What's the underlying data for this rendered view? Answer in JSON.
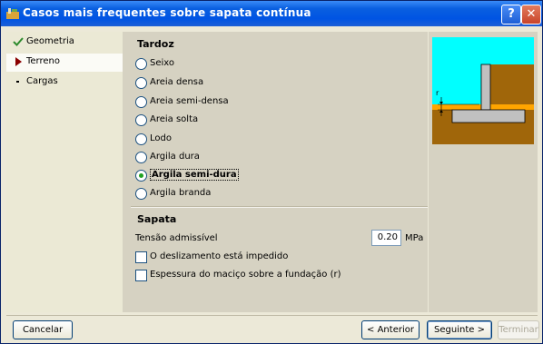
{
  "window": {
    "title": "Casos mais frequentes sobre sapata contínua",
    "help_label": "?",
    "close_label": "✕"
  },
  "sidebar": {
    "items": [
      {
        "label": "Geometria",
        "icon": "checkmark-icon"
      },
      {
        "label": "Terreno",
        "icon": "triangle-arrow-icon"
      },
      {
        "label": "Cargas",
        "icon": "bullet-icon"
      }
    ]
  },
  "tardoz": {
    "title": "Tardoz",
    "options": [
      "Seixo",
      "Areia densa",
      "Areia semi-densa",
      "Areia solta",
      "Lodo",
      "Argila dura",
      "Argila semi-dura",
      "Argila branda"
    ],
    "selected": "Argila semi-dura"
  },
  "sapata": {
    "title": "Sapata",
    "tensao_label": "Tensão admissível",
    "tensao_value": "0.20",
    "tensao_unit": "MPa",
    "check1_label": "O deslizamento está impedido",
    "check2_label": "Espessura do maciço sobre a fundação (r)"
  },
  "preview": {
    "r_label": "r",
    "colors": {
      "sky": "#00ffff",
      "soil": "#a0660a",
      "water": "#ffa500",
      "concrete": "#c0c0c0"
    }
  },
  "buttons": {
    "cancel": "Cancelar",
    "previous": "< Anterior",
    "next": "Seguinte >",
    "finish": "Terminar"
  }
}
